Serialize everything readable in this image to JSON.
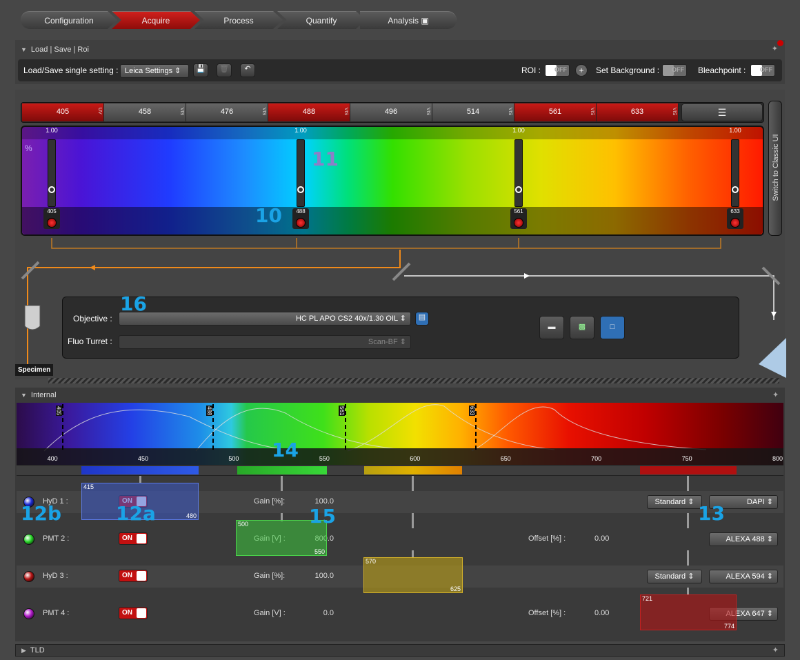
{
  "workflow": {
    "steps": [
      "Configuration",
      "Acquire",
      "Process",
      "Quantify",
      "Analysis"
    ],
    "active": "Acquire"
  },
  "load_panel": {
    "title": "Load | Save | Roi",
    "setting_label": "Load/Save single setting :",
    "setting_value": "Leica Settings",
    "roi_label": "ROI :",
    "roi_state": "OFF",
    "bg_label": "Set Background :",
    "bg_state": "OFF",
    "bleach_label": "Bleachpoint :",
    "bleach_state": "OFF"
  },
  "lasers": {
    "tabs": [
      {
        "wl": "405",
        "tag": "UV",
        "active": true
      },
      {
        "wl": "458",
        "tag": "VIS",
        "active": false
      },
      {
        "wl": "476",
        "tag": "VIS",
        "active": false
      },
      {
        "wl": "488",
        "tag": "VIS",
        "active": true
      },
      {
        "wl": "496",
        "tag": "VIS",
        "active": false
      },
      {
        "wl": "514",
        "tag": "VIS",
        "active": false
      },
      {
        "wl": "561",
        "tag": "VIS",
        "active": true
      },
      {
        "wl": "633",
        "tag": "VIS",
        "active": true
      }
    ],
    "percent_symbol": "%",
    "sliders": [
      {
        "wl": "405",
        "value": "1.00"
      },
      {
        "wl": "488",
        "value": "1.00"
      },
      {
        "wl": "561",
        "value": "1.00"
      },
      {
        "wl": "633",
        "value": "1.00"
      }
    ],
    "side_button": "Switch to Classic UI"
  },
  "callouts": {
    "c10": "10",
    "c11": "11",
    "c12a": "12a",
    "c12b": "12b",
    "c13": "13",
    "c14": "14",
    "c15": "15",
    "c16": "16"
  },
  "optics": {
    "objective_label": "Objective :",
    "objective_value": "HC PL APO CS2   40x/1.30 OIL",
    "turret_label": "Fluo Turret :",
    "turret_value": "Scan-BF",
    "specimen_label": "Specimen"
  },
  "internal": {
    "title": "Internal",
    "axis_ticks": [
      "400",
      "450",
      "500",
      "550",
      "600",
      "650",
      "700",
      "750",
      "800"
    ],
    "laser_lines": [
      "405",
      "488",
      "561",
      "633"
    ]
  },
  "detectors": [
    {
      "name": "HyD 1 :",
      "state": "ON",
      "gain_label": "Gain [%]:",
      "gain": "100.0",
      "offset_label": "",
      "offset": "",
      "mode": "Standard",
      "dye": "DAPI",
      "range_lo": "415",
      "range_hi": "480",
      "color": "#1f2dd6"
    },
    {
      "name": "PMT 2 :",
      "state": "ON",
      "gain_label": "Gain [V] :",
      "gain": "800.0",
      "offset_label": "Offset [%] :",
      "offset": "0.00",
      "mode": "",
      "dye": "ALEXA 488",
      "range_lo": "500",
      "range_hi": "550",
      "color": "#2ad62a"
    },
    {
      "name": "HyD 3 :",
      "state": "ON",
      "gain_label": "Gain [%]:",
      "gain": "100.0",
      "offset_label": "",
      "offset": "",
      "mode": "Standard",
      "dye": "ALEXA 594",
      "range_lo": "570",
      "range_hi": "625",
      "color": "#b51515"
    },
    {
      "name": "PMT 4 :",
      "state": "ON",
      "gain_label": "Gain [V] :",
      "gain": "0.0",
      "offset_label": "Offset [%] :",
      "offset": "0.00",
      "mode": "",
      "dye": "ALEXA 647",
      "range_lo": "721",
      "range_hi": "774",
      "color": "#b019c9"
    }
  ],
  "tld": {
    "title": "TLD"
  }
}
